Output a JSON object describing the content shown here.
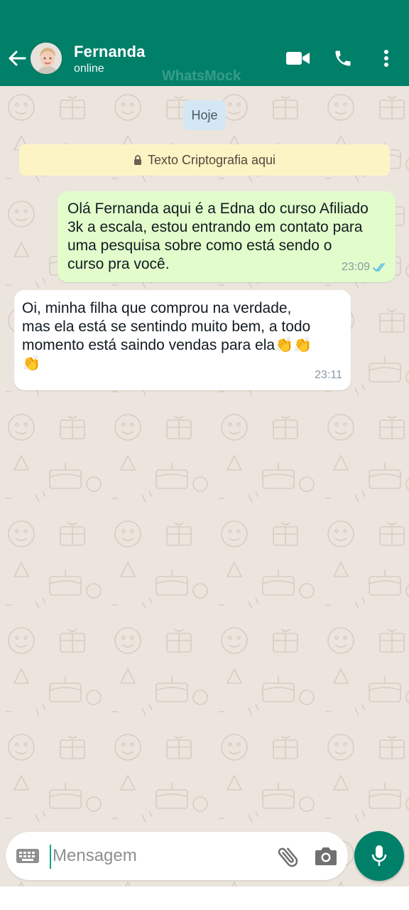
{
  "header": {
    "contact_name": "Fernanda",
    "status": "online",
    "watermark": "WhatsMock",
    "background_color": "#008069",
    "icons": [
      "back-arrow-icon",
      "video-call-icon",
      "phone-icon",
      "more-vertical-icon"
    ]
  },
  "chat": {
    "date_label": "Hoje",
    "encryption_notice": "Texto Criptografia aqui",
    "messages": [
      {
        "direction": "outgoing",
        "text": "Olá Fernanda aqui é a Edna do curso Afiliado\n3k a escala, estou entrando em contato para\numa pesquisa sobre como está sendo o\ncurso pra você.",
        "time": "23:09",
        "status": "read"
      },
      {
        "direction": "incoming",
        "text": "Oi, minha filha que comprou na verdade,\nmas ela está se sentindo muito bem, a todo\nmomento está saindo vendas para ela👏👏\n👏",
        "time": "23:11"
      }
    ]
  },
  "composer": {
    "placeholder": "Mensagem",
    "value": "",
    "icons": [
      "keyboard-icon",
      "paperclip-icon",
      "camera-icon",
      "microphone-icon"
    ]
  },
  "colors": {
    "chat_background": "#ece5dd",
    "outgoing_bubble": "#e2fdcb",
    "incoming_bubble": "#ffffff",
    "read_ticks": "#53bdeb",
    "accent": "#008069"
  }
}
